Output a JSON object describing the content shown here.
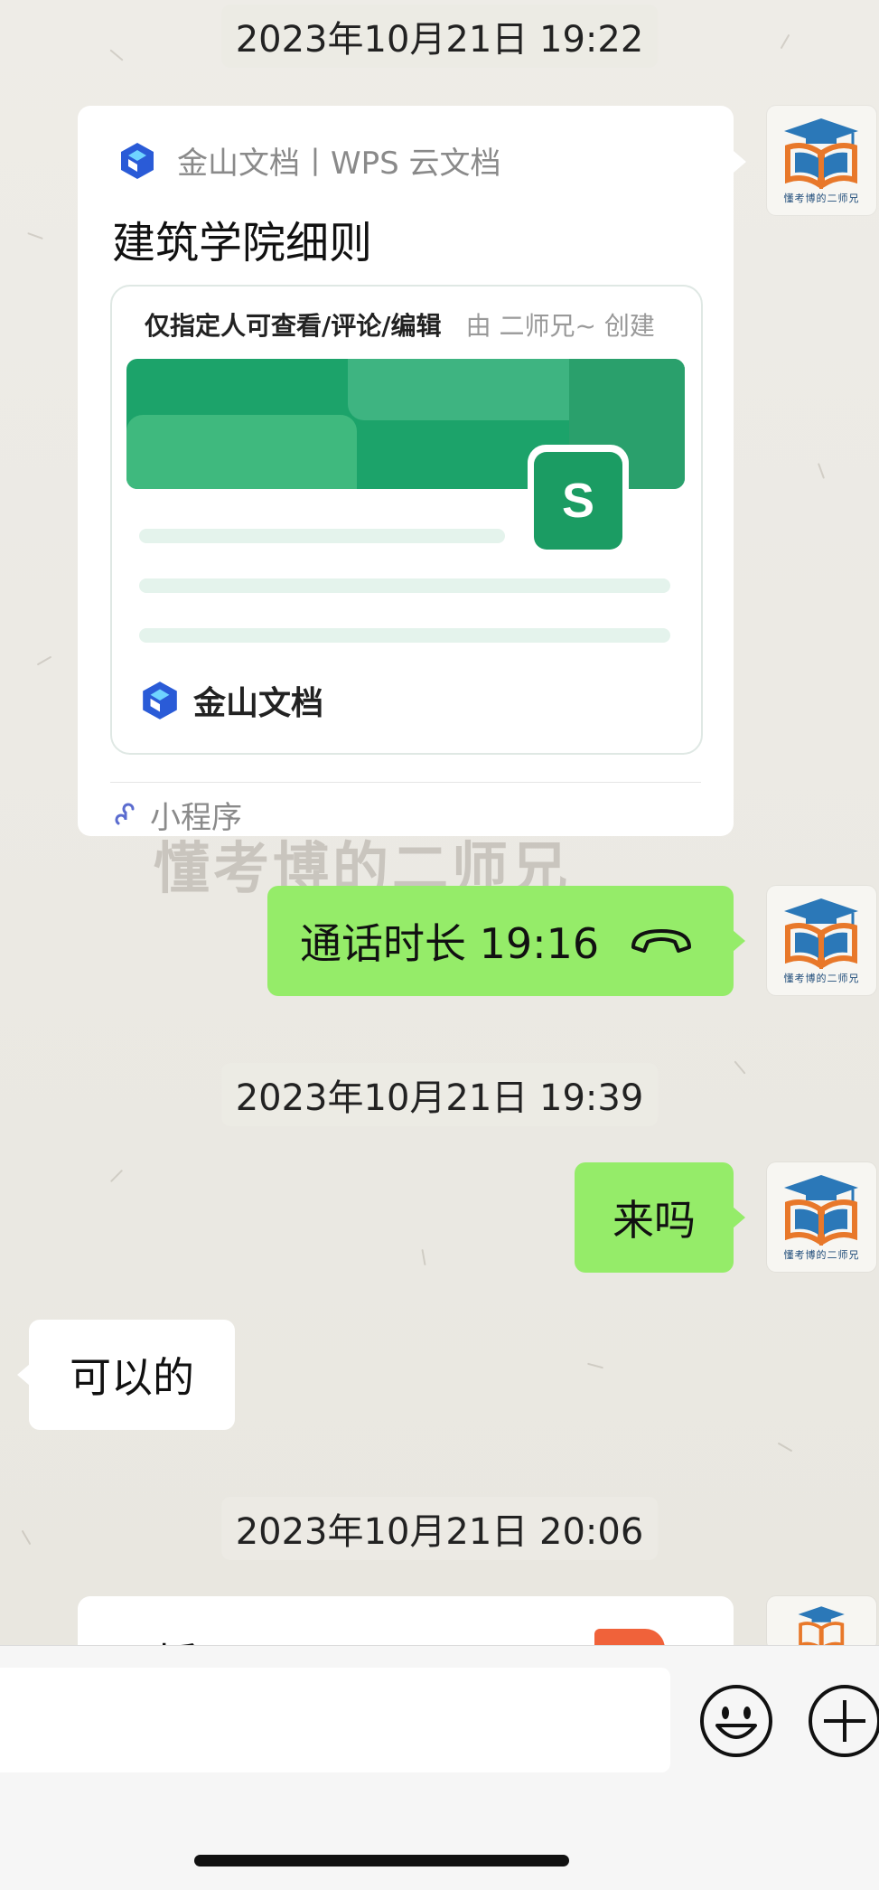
{
  "timestamps": [
    "2023年10月21日 19:22",
    "2023年10月21日 19:39",
    "2023年10月21日 20:06"
  ],
  "avatar": {
    "caption": "懂考博的二师兄",
    "icon": "graduation-cap-book-logo"
  },
  "doc_card": {
    "source": "金山文档丨WPS 云文档",
    "title": "建筑学院细则",
    "permission": "仅指定人可查看/评论/编辑",
    "creator": "由 二师兄~ 创建",
    "sheet_letter": "S",
    "brand": "金山文档",
    "mini_program_label": "小程序"
  },
  "watermark": "懂考博的二师兄",
  "messages": {
    "call_text": "通话时长 19:16",
    "call_icon": "phone-hangup-icon",
    "laima": "来吗",
    "reply": "可以的"
  },
  "partial_card": {
    "title": "工播.pptx"
  },
  "input_bar": {
    "emoji_icon": "emoji-icon",
    "plus_icon": "plus-icon"
  },
  "colors": {
    "green_bubble": "#95ec69",
    "sheet_green": "#1b9c63",
    "wps_blue": "#2a5bd7",
    "file_orange": "#f0623a"
  }
}
